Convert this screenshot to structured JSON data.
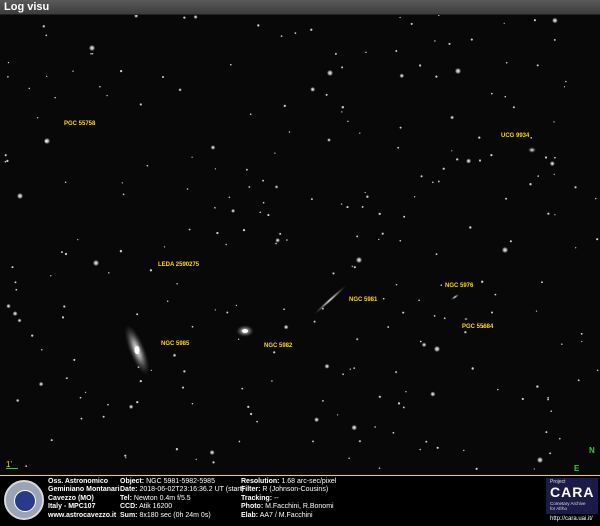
{
  "window": {
    "title": "Log visu"
  },
  "image": {
    "scale_label": "1'",
    "compass": {
      "north": "N",
      "east": "E"
    },
    "labels": [
      {
        "id": "pgc-55758",
        "text": "PGC 55758"
      },
      {
        "id": "ucg-9934",
        "text": "UCG 9934"
      },
      {
        "id": "leda-2590275",
        "text": "LEDA 2590275"
      },
      {
        "id": "ngc-5981",
        "text": "NGC 5981"
      },
      {
        "id": "ngc-5976",
        "text": "NGC 5976"
      },
      {
        "id": "pgc-55684",
        "text": "PGC 55684"
      },
      {
        "id": "ngc-5985",
        "text": "NGC 5985"
      },
      {
        "id": "ngc-5982",
        "text": "NGC 5982"
      }
    ]
  },
  "info": {
    "observatory": [
      "Oss. Astronomico",
      "Geminiano Montanari",
      "Cavezzo (MO)",
      "Italy - MPC107",
      "www.astrocavezzo.it"
    ],
    "details": [
      {
        "k": "Object:",
        "v": "NGC 5981-5982-5985"
      },
      {
        "k": "Date:",
        "v": "2018-06-02T23:16:36.2 UT (start)"
      },
      {
        "k": "Tel:",
        "v": "Newton 0.4m f/5.5"
      },
      {
        "k": "CCD:",
        "v": "Atik 16200"
      },
      {
        "k": "Sum:",
        "v": "8x180 sec (0h 24m 0s)"
      }
    ],
    "details2": [
      {
        "k": "Resolution:",
        "v": "1.68 arc-sec/pixel"
      },
      {
        "k": "Filter:",
        "v": "R (Johnson-Cousins)"
      },
      {
        "k": "Tracking:",
        "v": "--"
      },
      {
        "k": "Photo:",
        "v": "M.Facchini, R.Bonomi"
      },
      {
        "k": "Elab:",
        "v": "AA7 / M.Facchini"
      }
    ],
    "cara": {
      "project": "Project",
      "name": "CARA",
      "sub1": "Cometary Archive",
      "sub2": "for Afrho",
      "url": "http://cara.uai.it/"
    }
  }
}
